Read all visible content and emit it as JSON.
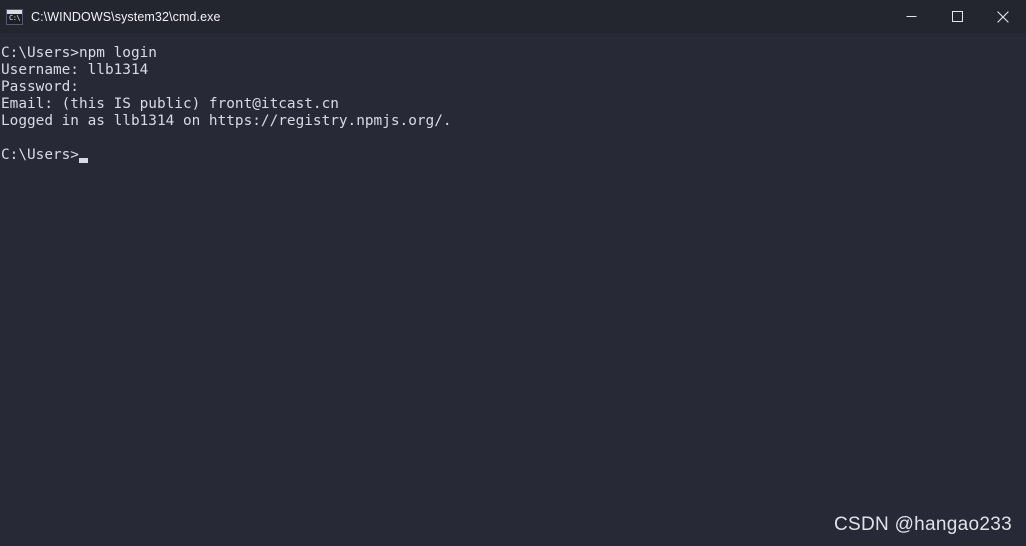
{
  "titlebar": {
    "title": "C:\\WINDOWS\\system32\\cmd.exe",
    "icon_name": "cmd-console-icon",
    "icon_glyphs": "C:\\",
    "minimize_label": "Minimize",
    "maximize_label": "Maximize",
    "close_label": "Close"
  },
  "terminal": {
    "lines": [
      "C:\\Users>npm login",
      "Username: llb1314",
      "Password:",
      "Email: (this IS public) front@itcast.cn",
      "Logged in as llb1314 on https://registry.npmjs.org/."
    ],
    "prompt": "C:\\Users>",
    "cursor": "block"
  },
  "watermark": {
    "text": "CSDN @hangao233"
  },
  "colors": {
    "titlebar_bg": "#23262f",
    "terminal_bg": "#272a36",
    "terminal_fg": "#d7dbe4",
    "title_fg": "#f0f2f6",
    "watermark_fg": "#dfe2e9"
  }
}
